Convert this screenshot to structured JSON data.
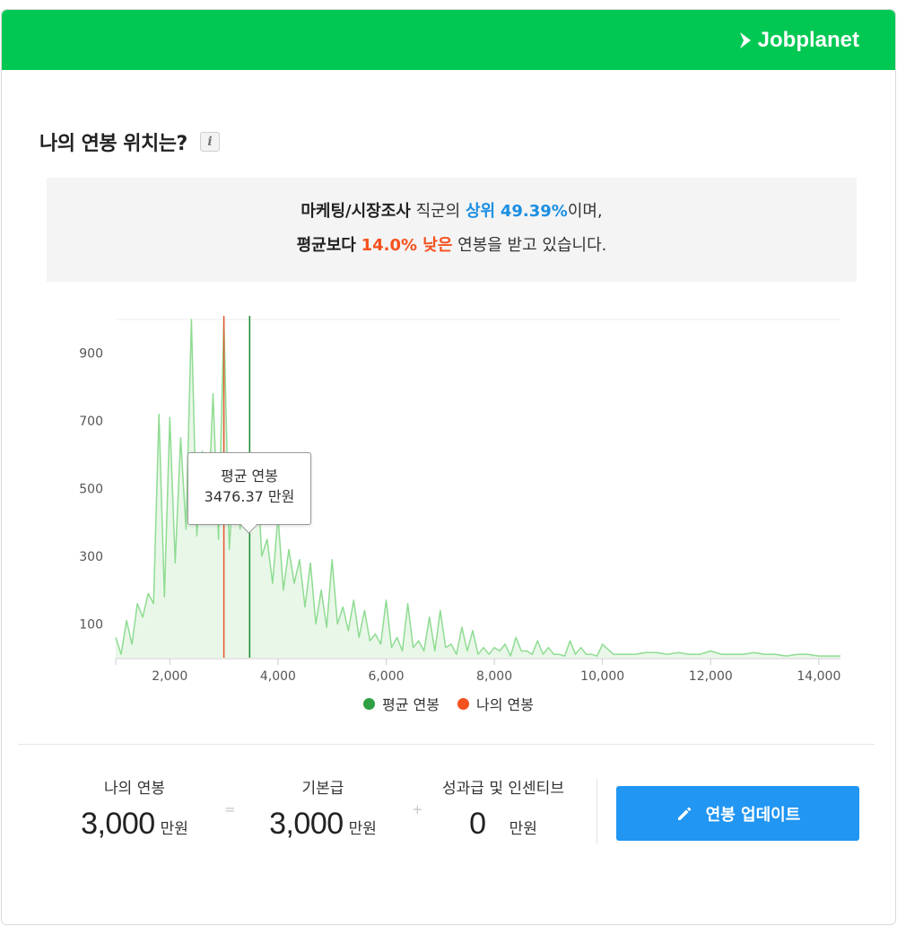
{
  "brand": {
    "name": "Jobplanet",
    "color": "#00c853"
  },
  "section": {
    "title": "나의 연봉 위치는?",
    "info_icon": "info-icon",
    "info_text": "i"
  },
  "summary": {
    "line1_job": "마케팅/시장조사",
    "line1_mid": " 직군의 ",
    "line1_rank_label": "상위",
    "line1_rank_value": "49.39%",
    "line1_end": "이며,",
    "line2_prefix": "평균보다",
    "line2_diff": "14.0% 낮은",
    "line2_end": " 연봉을 받고 있습니다."
  },
  "tooltip": {
    "title": "평균 연봉",
    "value": "3476.37 만원"
  },
  "legend": [
    {
      "label": "평균 연봉",
      "color": "#2ea043"
    },
    {
      "label": "나의 연봉",
      "color": "#f4511e"
    }
  ],
  "chart_data": {
    "type": "area",
    "x_ticks": [
      "2,000",
      "4,000",
      "6,000",
      "8,000",
      "10,000",
      "12,000",
      "14,000"
    ],
    "y_ticks": [
      "100",
      "300",
      "500",
      "700",
      "900"
    ],
    "xlim": [
      1000,
      14400
    ],
    "ylim": [
      0,
      1000
    ],
    "average_salary": 3476.37,
    "my_salary": 3000,
    "average_color": "#1b8a2e",
    "my_color": "#e8542f",
    "series_color": "#8fdc92",
    "fill_color": "#e9f7e9",
    "x": [
      1000,
      1100,
      1200,
      1300,
      1400,
      1500,
      1600,
      1700,
      1800,
      1900,
      2000,
      2100,
      2200,
      2300,
      2400,
      2500,
      2600,
      2700,
      2800,
      2900,
      3000,
      3100,
      3200,
      3300,
      3400,
      3500,
      3600,
      3700,
      3800,
      3900,
      4000,
      4100,
      4200,
      4300,
      4400,
      4500,
      4600,
      4700,
      4800,
      4900,
      5000,
      5100,
      5200,
      5300,
      5400,
      5500,
      5600,
      5700,
      5800,
      5900,
      6000,
      6100,
      6200,
      6300,
      6400,
      6500,
      6600,
      6700,
      6800,
      6900,
      7000,
      7100,
      7200,
      7300,
      7400,
      7500,
      7600,
      7700,
      7800,
      7900,
      8000,
      8100,
      8200,
      8300,
      8400,
      8500,
      8600,
      8700,
      8800,
      8900,
      9000,
      9100,
      9200,
      9300,
      9400,
      9500,
      9600,
      9700,
      9800,
      9900,
      10000,
      10200,
      10400,
      10600,
      10800,
      11000,
      11200,
      11400,
      11600,
      11800,
      12000,
      12200,
      12400,
      12600,
      12800,
      13000,
      13200,
      13400,
      13600,
      13800,
      14000,
      14200,
      14400
    ],
    "y": [
      60,
      10,
      110,
      40,
      160,
      120,
      190,
      160,
      720,
      180,
      710,
      280,
      650,
      380,
      1000,
      360,
      610,
      400,
      780,
      350,
      1000,
      320,
      580,
      380,
      600,
      520,
      600,
      300,
      350,
      220,
      420,
      200,
      320,
      220,
      290,
      150,
      280,
      100,
      200,
      90,
      290,
      100,
      150,
      80,
      170,
      60,
      140,
      50,
      70,
      40,
      170,
      30,
      60,
      20,
      160,
      30,
      50,
      20,
      120,
      20,
      140,
      30,
      40,
      10,
      90,
      20,
      80,
      10,
      30,
      10,
      30,
      20,
      40,
      5,
      60,
      20,
      20,
      10,
      50,
      10,
      30,
      10,
      10,
      5,
      50,
      10,
      30,
      10,
      10,
      5,
      40,
      10,
      10,
      10,
      15,
      15,
      10,
      15,
      10,
      10,
      20,
      10,
      10,
      10,
      15,
      10,
      10,
      5,
      10,
      10,
      5,
      5,
      5
    ]
  },
  "stats": {
    "my_salary": {
      "label": "나의 연봉",
      "value": "3,000",
      "unit": "만원"
    },
    "equals": "=",
    "base_pay": {
      "label": "기본급",
      "value": "3,000",
      "unit": "만원"
    },
    "plus": "+",
    "bonus": {
      "label": "성과급 및 인센티브",
      "value": "0",
      "unit": "만원"
    }
  },
  "update_button": {
    "label": "연봉 업데이트",
    "icon": "pencil-icon",
    "color": "#2196f3"
  }
}
